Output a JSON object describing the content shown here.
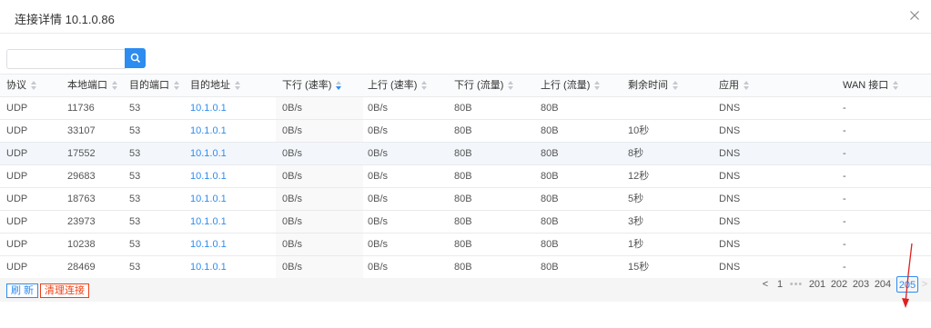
{
  "modal": {
    "title": "连接详情 10.1.0.86"
  },
  "search": {
    "value": "",
    "placeholder": ""
  },
  "table": {
    "columns": [
      "协议",
      "本地端口",
      "目的端口",
      "目的地址",
      "下行 (速率)",
      "上行 (速率)",
      "下行 (流量)",
      "上行 (流量)",
      "剩余时间",
      "应用",
      "WAN 接口"
    ],
    "rows": [
      [
        "UDP",
        "11736",
        "53",
        "10.1.0.1",
        "0B/s",
        "0B/s",
        "80B",
        "80B",
        "",
        "DNS",
        "-"
      ],
      [
        "UDP",
        "33107",
        "53",
        "10.1.0.1",
        "0B/s",
        "0B/s",
        "80B",
        "80B",
        "10秒",
        "DNS",
        "-"
      ],
      [
        "UDP",
        "17552",
        "53",
        "10.1.0.1",
        "0B/s",
        "0B/s",
        "80B",
        "80B",
        "8秒",
        "DNS",
        "-"
      ],
      [
        "UDP",
        "29683",
        "53",
        "10.1.0.1",
        "0B/s",
        "0B/s",
        "80B",
        "80B",
        "12秒",
        "DNS",
        "-"
      ],
      [
        "UDP",
        "18763",
        "53",
        "10.1.0.1",
        "0B/s",
        "0B/s",
        "80B",
        "80B",
        "5秒",
        "DNS",
        "-"
      ],
      [
        "UDP",
        "23973",
        "53",
        "10.1.0.1",
        "0B/s",
        "0B/s",
        "80B",
        "80B",
        "3秒",
        "DNS",
        "-"
      ],
      [
        "UDP",
        "10238",
        "53",
        "10.1.0.1",
        "0B/s",
        "0B/s",
        "80B",
        "80B",
        "1秒",
        "DNS",
        "-"
      ],
      [
        "UDP",
        "28469",
        "53",
        "10.1.0.1",
        "0B/s",
        "0B/s",
        "80B",
        "80B",
        "15秒",
        "DNS",
        "-"
      ]
    ]
  },
  "actions": {
    "refresh": "刷 新",
    "clear": "清理连接"
  },
  "pagination": {
    "prev": "<",
    "first": "1",
    "ellipsis": "•••",
    "pages": [
      "201",
      "202",
      "203",
      "204",
      "205"
    ],
    "current": "205",
    "next": ">"
  },
  "colors": {
    "accent": "#2d8cf0",
    "danger": "#ed4014",
    "annotation": "#e02020"
  },
  "icons": {
    "search": "search-icon",
    "close": "close-icon",
    "sort": "sort-icon",
    "annotation": "red-arrow-annotation"
  }
}
